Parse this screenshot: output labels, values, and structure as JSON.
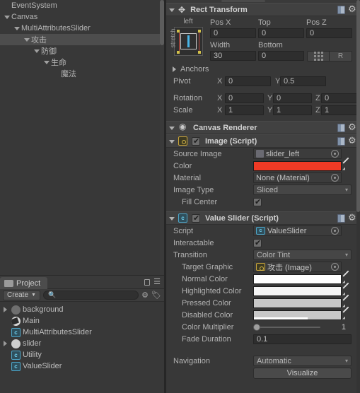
{
  "hierarchy": {
    "items": [
      {
        "label": "EventSystem",
        "depth": 0,
        "twisty": false,
        "selected": false
      },
      {
        "label": "Canvas",
        "depth": 0,
        "twisty": true,
        "selected": false
      },
      {
        "label": "MultiAttributesSlider",
        "depth": 1,
        "twisty": true,
        "selected": false
      },
      {
        "label": "攻击",
        "depth": 2,
        "twisty": true,
        "selected": true
      },
      {
        "label": "防御",
        "depth": 3,
        "twisty": true,
        "selected": false
      },
      {
        "label": "生命",
        "depth": 4,
        "twisty": true,
        "selected": false
      },
      {
        "label": "魔法",
        "depth": 5,
        "twisty": false,
        "selected": false
      }
    ]
  },
  "project": {
    "tab_label": "Project",
    "tab_icon": "folder-icon",
    "lock_icon": "lock-icon",
    "menu_icon": "panel-menu-icon",
    "create_label": "Create",
    "search_placeholder": "",
    "filter_type_icon": "filter-type-icon",
    "filter_label_icon": "filter-label-icon",
    "items": [
      {
        "label": "background",
        "icon": "prefab-icon",
        "expandable": true
      },
      {
        "label": "Main",
        "icon": "scene-icon",
        "expandable": false
      },
      {
        "label": "MultiAttributesSlider",
        "icon": "csharp-script-icon",
        "expandable": false
      },
      {
        "label": "slider",
        "icon": "sprite-icon",
        "expandable": true
      },
      {
        "label": "Utility",
        "icon": "csharp-script-icon",
        "expandable": false
      },
      {
        "label": "ValueSlider",
        "icon": "csharp-script-icon",
        "expandable": false
      }
    ]
  },
  "inspector": {
    "rect_transform": {
      "title": "Rect Transform",
      "anchor_preset_h": "left",
      "anchor_preset_v": "stretch",
      "fields": {
        "pos_x_label": "Pos X",
        "pos_x_value": "0",
        "top_label": "Top",
        "top_value": "0",
        "pos_z_label": "Pos Z",
        "pos_z_value": "0",
        "width_label": "Width",
        "width_value": "30",
        "bottom_label": "Bottom",
        "bottom_value": "0"
      },
      "blueprint_label": "",
      "raw_label": "R",
      "anchors_label": "Anchors",
      "pivot_label": "Pivot",
      "pivot_x": "0",
      "pivot_y": "0.5",
      "rotation_label": "Rotation",
      "rotation_x": "0",
      "rotation_y": "0",
      "rotation_z": "0",
      "scale_label": "Scale",
      "scale_x": "1",
      "scale_y": "1",
      "scale_z": "1",
      "axis_x": "X",
      "axis_y": "Y",
      "axis_z": "Z"
    },
    "canvas_renderer": {
      "title": "Canvas Renderer"
    },
    "image": {
      "title": "Image (Script)",
      "enabled": true,
      "source_image_label": "Source Image",
      "source_image_value": "slider_left",
      "color_label": "Color",
      "color_value": "#EF3A25",
      "material_label": "Material",
      "material_value": "None (Material)",
      "image_type_label": "Image Type",
      "image_type_value": "Sliced",
      "fill_center_label": "Fill Center",
      "fill_center_checked": true
    },
    "value_slider": {
      "title": "Value Slider (Script)",
      "enabled": true,
      "script_label": "Script",
      "script_value": "ValueSlider",
      "interactable_label": "Interactable",
      "interactable_checked": true,
      "transition_label": "Transition",
      "transition_value": "Color Tint",
      "target_graphic_label": "Target Graphic",
      "target_graphic_value": "攻击 (Image)",
      "normal_color_label": "Normal Color",
      "normal_color_value": "#FFFFFF",
      "highlighted_color_label": "Highlighted Color",
      "highlighted_color_value": "#F5F5F5",
      "pressed_color_label": "Pressed Color",
      "pressed_color_value": "#C8C8C8",
      "disabled_color_label": "Disabled Color",
      "disabled_color_value": "#C8C8C8",
      "color_multiplier_label": "Color Multiplier",
      "color_multiplier_value": "1",
      "fade_duration_label": "Fade Duration",
      "fade_duration_value": "0.1",
      "navigation_label": "Navigation",
      "navigation_value": "Automatic",
      "visualize_label": "Visualize"
    }
  }
}
